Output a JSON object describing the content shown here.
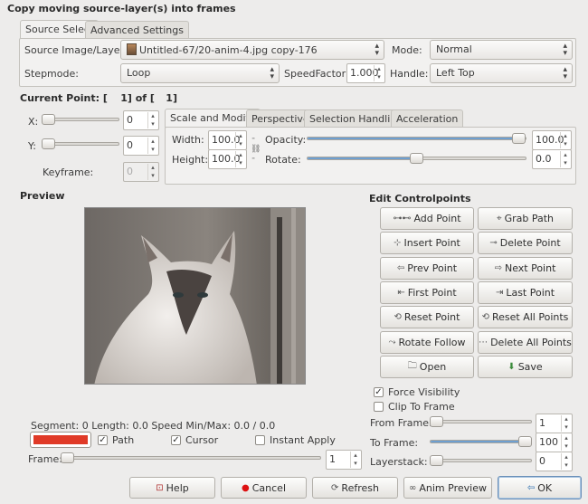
{
  "window": {
    "title": "Copy moving source-layer(s) into frames"
  },
  "top_tabs": {
    "source_select": "Source Select",
    "advanced_settings": "Advanced Settings"
  },
  "source": {
    "image_layer_label": "Source Image/Layer:",
    "image_layer_value": "Untitled-67/20-anim-4.jpg copy-176",
    "mode_label": "Mode:",
    "mode_value": "Normal",
    "stepmode_label": "Stepmode:",
    "stepmode_value": "Loop",
    "speedfactor_label": "SpeedFactor:",
    "speedfactor_value": "1.000",
    "handle_label": "Handle:",
    "handle_value": "Left  Top"
  },
  "current_point": {
    "prefix": "Current Point: [",
    "current": "1",
    "middle": "] of [",
    "total": "1",
    "suffix": "]"
  },
  "point": {
    "x_label": "X:",
    "x_value": "0",
    "y_label": "Y:",
    "y_value": "0",
    "keyframe_label": "Keyframe:",
    "keyframe_value": "0"
  },
  "sub_tabs": {
    "scale_modify": "Scale and Modify",
    "perspective": "Perspective",
    "selection_handling": "Selection Handling",
    "acceleration": "Acceleration"
  },
  "scale": {
    "width_label": "Width:",
    "width_value": "100.0",
    "height_label": "Height:",
    "height_value": "100.0",
    "opacity_label": "Opacity:",
    "opacity_value": "100.0",
    "opacity_level": 1.0,
    "rotate_label": "Rotate:",
    "rotate_value": "0.0",
    "rotate_level": 0.5
  },
  "preview": {
    "heading": "Preview"
  },
  "edit_controlpoints": {
    "heading": "Edit Controlpoints",
    "add_point": "Add Point",
    "grab_path": "Grab Path",
    "insert_point": "Insert Point",
    "delete_point": "Delete Point",
    "prev_point": "Prev Point",
    "next_point": "Next Point",
    "first_point": "First Point",
    "last_point": "Last Point",
    "reset_point": "Reset Point",
    "reset_all_points": "Reset All Points",
    "rotate_follow": "Rotate Follow",
    "delete_all_points": "Delete All Points",
    "open": "Open",
    "save": "Save"
  },
  "options": {
    "force_visibility": "Force Visibility",
    "clip_to_frame": "Clip To Frame",
    "force_visibility_checked": true,
    "clip_to_frame_checked": false
  },
  "frames": {
    "from_label": "From Frame:",
    "from_value": "1",
    "to_label": "To Frame:",
    "to_value": "100",
    "layerstack_label": "Layerstack:",
    "layerstack_value": "0"
  },
  "status": {
    "segment_label": "Segment:",
    "segment_value": "0",
    "length_label": "Length:",
    "length_value": "0.0",
    "speed_label": "Speed Min/Max:",
    "speed_value": "0.0 / 0.0"
  },
  "path_color": "#e03a27",
  "preview_checks": {
    "path": "Path",
    "cursor": "Cursor",
    "instant_apply": "Instant Apply",
    "path_checked": true,
    "cursor_checked": true,
    "instant_apply_checked": false
  },
  "frame_slider": {
    "label": "Frame:",
    "value": "1"
  },
  "actions": {
    "help": "Help",
    "cancel": "Cancel",
    "refresh": "Refresh",
    "anim_preview": "Anim Preview",
    "ok": "OK"
  }
}
